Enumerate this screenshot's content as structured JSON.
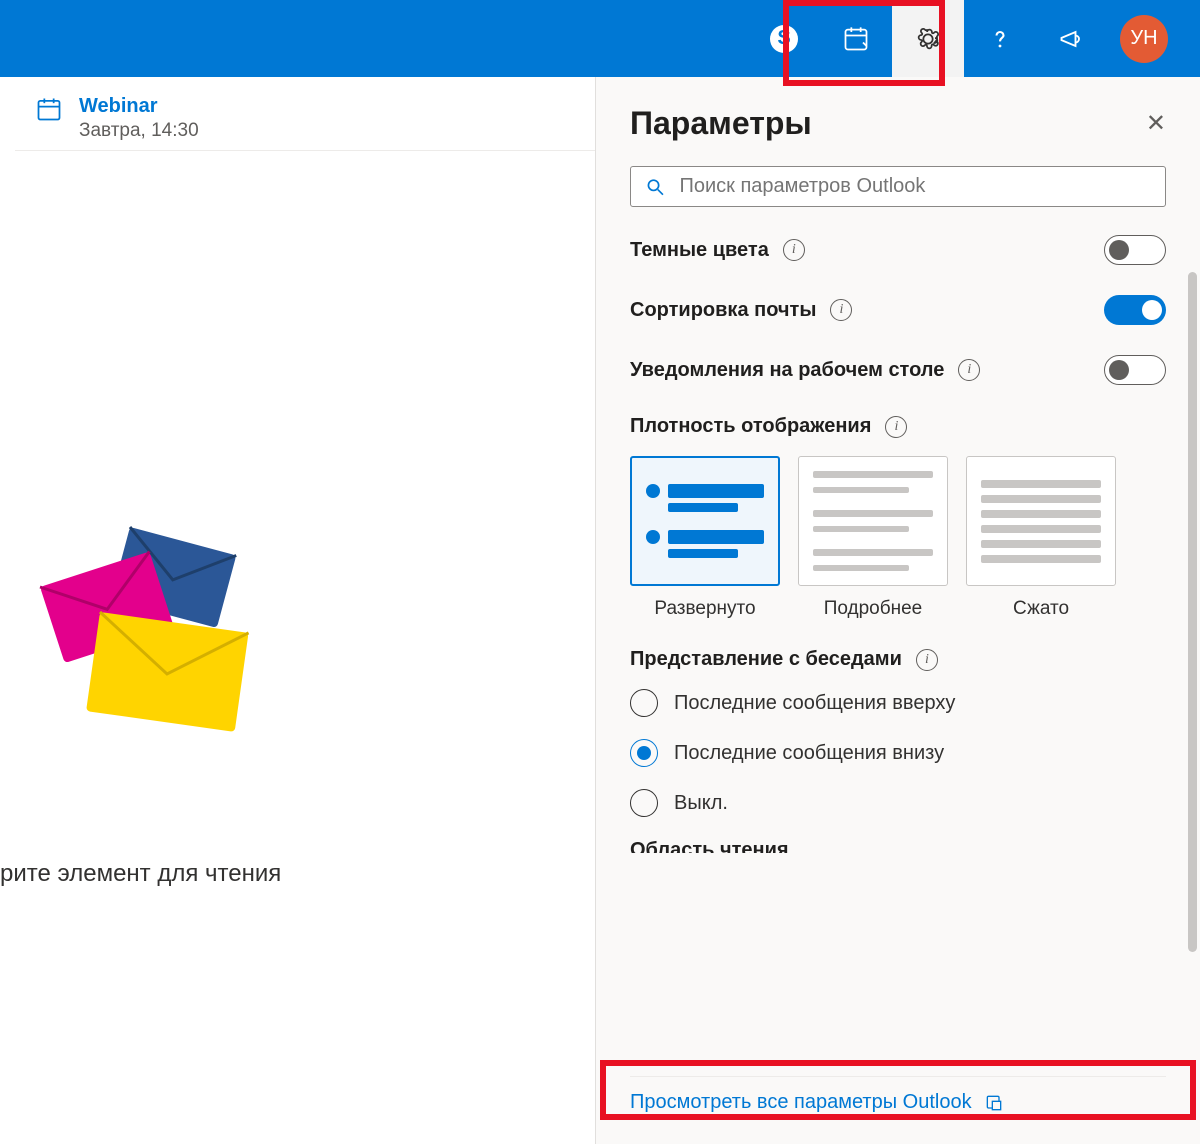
{
  "header": {
    "avatar_initials": "УН"
  },
  "calendar": {
    "title": "Webinar",
    "time": "Завтра, 14:30"
  },
  "reading_prompt": "рите элемент для чтения",
  "panel": {
    "title": "Параметры",
    "search_placeholder": "Поиск параметров Outlook",
    "settings": {
      "dark_mode": {
        "label": "Темные цвета",
        "on": false
      },
      "sorted_inbox": {
        "label": "Сортировка почты",
        "on": true
      },
      "desktop_notifications": {
        "label": "Уведомления на рабочем столе",
        "on": false
      }
    },
    "density": {
      "title": "Плотность отображения",
      "options": {
        "full": "Развернуто",
        "medium": "Подробнее",
        "compact": "Сжато"
      },
      "selected": "full"
    },
    "conversation": {
      "title": "Представление с беседами",
      "options": {
        "newest_top": "Последние сообщения вверху",
        "newest_bottom": "Последние сообщения внизу",
        "off": "Выкл."
      },
      "selected": "newest_bottom"
    },
    "reading_pane_title_partial": "Область чтения",
    "view_all_link": "Просмотреть все параметры Outlook"
  }
}
